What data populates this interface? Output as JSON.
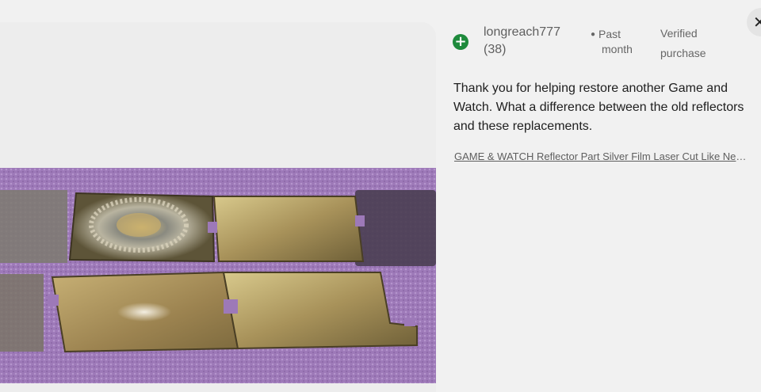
{
  "review": {
    "author": "longreach777",
    "author_count": "(38)",
    "date_line1": "Past",
    "date_line2": "month",
    "verified_line1": "Verified",
    "verified_line2": "purchase",
    "text": "Thank you for helping restore another Game and Watch. What a difference between the old reflectors and these replacements.",
    "product_link": "GAME & WATCH Reflector Part Silver Film Laser Cut Like New Replacement"
  },
  "icons": {
    "add": "plus-circle-icon",
    "close": "close-icon"
  },
  "colors": {
    "accent_green": "#1e8a3c",
    "background": "#f1f1f1",
    "photo_background": "#9b77b6"
  }
}
